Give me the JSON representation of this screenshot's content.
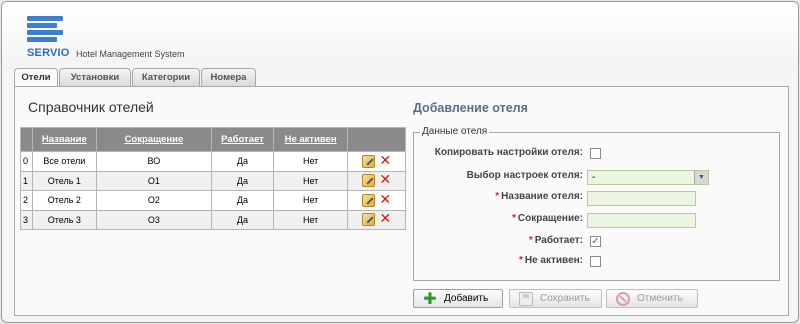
{
  "brand": {
    "logo_text": "SERVIO",
    "system_name": "Hotel Management System",
    "accent": "#3f7fc9"
  },
  "tabs": [
    {
      "label": "Отели",
      "active": true
    },
    {
      "label": "Установки",
      "active": false
    },
    {
      "label": "Категории",
      "active": false
    },
    {
      "label": "Номера",
      "active": false
    }
  ],
  "list": {
    "title": "Справочник отелей",
    "columns": [
      "Название",
      "Сокращение",
      "Работает",
      "Не активен"
    ],
    "rows": [
      {
        "index": "0",
        "name": "Все отели",
        "short": "ВО",
        "works": "Да",
        "inactive": "Нет"
      },
      {
        "index": "1",
        "name": "Отель 1",
        "short": "О1",
        "works": "Да",
        "inactive": "Нет"
      },
      {
        "index": "2",
        "name": "Отель 2",
        "short": "О2",
        "works": "Да",
        "inactive": "Нет"
      },
      {
        "index": "3",
        "name": "Отель 3",
        "short": "О3",
        "works": "Да",
        "inactive": "Нет"
      }
    ],
    "row_icons": [
      "edit-icon",
      "delete-icon"
    ]
  },
  "form": {
    "title": "Добавление отеля",
    "legend": "Данные отеля",
    "copy_settings_label": "Копировать настройки отеля:",
    "copy_settings_checked": false,
    "select_settings_label": "Выбор настроек отеля:",
    "select_settings_value": "-",
    "required_mark": "*",
    "name_label": "Название отеля:",
    "name_value": "",
    "short_label": "Сокращение:",
    "short_value": "",
    "works_label": "Работает:",
    "works_checked": true,
    "inactive_label": "Не активен:",
    "inactive_checked": false
  },
  "buttons": {
    "add": "Добавить",
    "save": "Сохранить",
    "cancel": "Отменить"
  }
}
